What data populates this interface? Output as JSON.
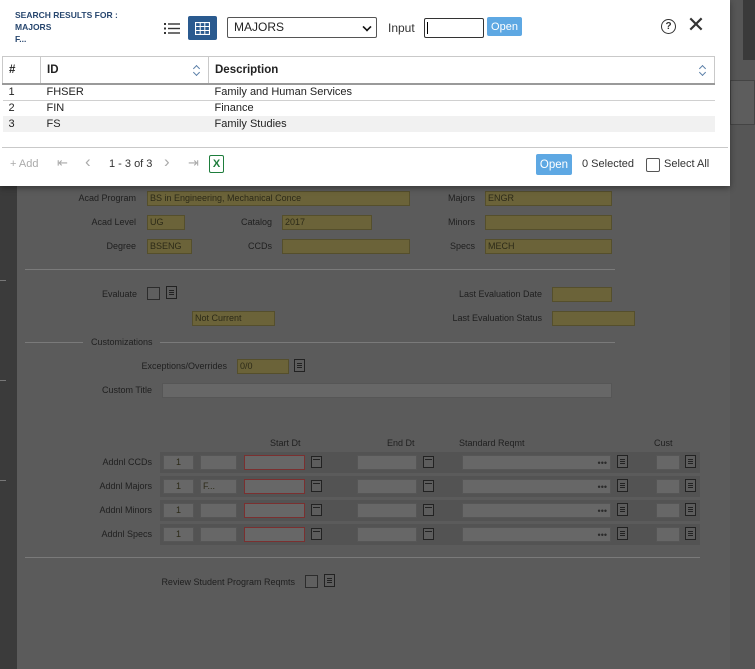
{
  "form": {
    "acad_program_label": "Acad Program",
    "acad_program_value": "BS in Engineering, Mechanical Conce",
    "majors_label": "Majors",
    "majors_value": "ENGR",
    "acad_level_label": "Acad Level",
    "acad_level_value": "UG",
    "catalog_label": "Catalog",
    "catalog_value": "2017",
    "minors_label": "Minors",
    "minors_value": "",
    "degree_label": "Degree",
    "degree_value": "BSENG",
    "ccds_label": "CCDs",
    "ccds_value": "",
    "specs_label": "Specs",
    "specs_value": "MECH",
    "evaluate_label": "Evaluate",
    "status_value": "Not Current",
    "last_eval_date_label": "Last Evaluation Date",
    "last_eval_date_value": "",
    "last_eval_status_label": "Last Evaluation Status",
    "last_eval_status_value": "",
    "customizations_label": "Customizations",
    "exceptions_label": "Exceptions/Overrides",
    "exceptions_value": "0/0",
    "custom_title_label": "Custom Title",
    "custom_title_value": "",
    "col_start_dt": "Start Dt",
    "col_end_dt": "End Dt",
    "col_std_reqmt": "Standard Reqmt",
    "col_cust": "Cust",
    "addnl_rows": [
      {
        "label": "Addnl CCDs",
        "count": "1",
        "code": ""
      },
      {
        "label": "Addnl Majors",
        "count": "1",
        "code": "F..."
      },
      {
        "label": "Addnl Minors",
        "count": "1",
        "code": ""
      },
      {
        "label": "Addnl Specs",
        "count": "1",
        "code": ""
      }
    ],
    "review_label": "Review Student Program Reqmts"
  },
  "modal": {
    "title_line1": "SEARCH RESULTS FOR :",
    "title_line2": "MAJORS",
    "title_line3": "F...",
    "dropdown_value": "MAJORS",
    "input_label": "Input",
    "input_value": "",
    "open_label": "Open",
    "help_symbol": "?",
    "close_symbol": "✕",
    "columns": [
      "#",
      "ID",
      "Description"
    ],
    "rows": [
      {
        "num": "1",
        "id": "FHSER",
        "desc": "Family and Human Services"
      },
      {
        "num": "2",
        "id": "FIN",
        "desc": "Finance"
      },
      {
        "num": "3",
        "id": "FS",
        "desc": "Family Studies"
      }
    ],
    "footer": {
      "add_label": "+ Add",
      "first_symbol": "⇤",
      "prev_symbol": "‹",
      "page_info": "1 - 3 of 3",
      "next_symbol": "›",
      "last_symbol": "⇥",
      "excel_symbol": "X",
      "open_label": "Open",
      "selected_text": "0 Selected",
      "select_all_label": "Select All"
    }
  },
  "colors": {
    "accent": "#2a5a8f",
    "button_blue": "#5ea8e3",
    "title_blue": "#28476f",
    "excel_green": "#1e7d3c",
    "dim_field": "#6b6339"
  }
}
